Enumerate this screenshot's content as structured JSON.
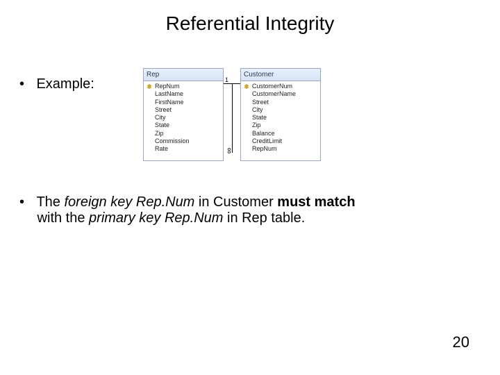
{
  "title": "Referential Integrity",
  "example_label": "Example:",
  "diagram": {
    "rep": {
      "header": "Rep",
      "fields": [
        "RepNum",
        "LastName",
        "FirstName",
        "Street",
        "City",
        "State",
        "Zip",
        "Commission",
        "Rate"
      ],
      "pk_index": 0
    },
    "customer": {
      "header": "Customer",
      "fields": [
        "CustomerNum",
        "CustomerName",
        "Street",
        "City",
        "State",
        "Zip",
        "Balance",
        "CreditLimit",
        "RepNum"
      ],
      "pk_index": 0
    },
    "cardinality": {
      "one": "1",
      "many": "∞"
    }
  },
  "sentence": {
    "p1": "The ",
    "fk": "foreign key Rep.Num",
    "p2": " in Customer ",
    "must": "must match",
    "p3": " with the ",
    "pk": "primary key Rep.Num",
    "p4": " in Rep table."
  },
  "page_number": "20"
}
